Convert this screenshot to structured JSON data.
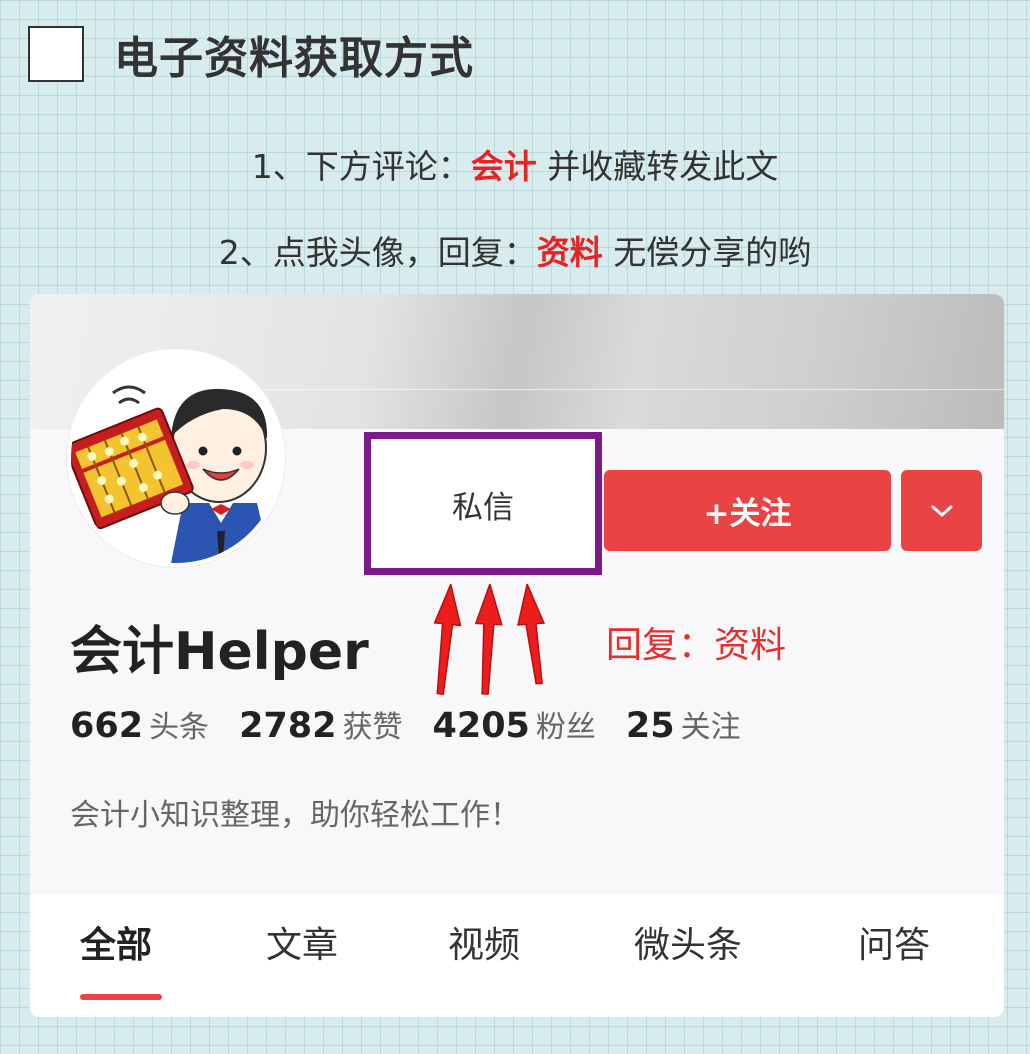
{
  "header": {
    "title": "电子资料获取方式"
  },
  "instructions": {
    "line1": {
      "prefix": "1、下方评论：",
      "highlight": "会计",
      "suffix": " 并收藏转发此文"
    },
    "line2": {
      "prefix": "2、点我头像，回复：",
      "highlight": "资料",
      "suffix": "  无偿分享的哟"
    }
  },
  "profile": {
    "name": "会计Helper",
    "message_button": "私信",
    "follow_button": "+关注",
    "more_icon": "chevron-down-icon",
    "reply_hint": "回复：资料",
    "stats": [
      {
        "value": "662",
        "label": "头条"
      },
      {
        "value": "2782",
        "label": "获赞"
      },
      {
        "value": "4205",
        "label": "粉丝"
      },
      {
        "value": "25",
        "label": "关注"
      }
    ],
    "bio": "会计小知识整理，助你轻松工作！"
  },
  "tabs": [
    {
      "label": "全部",
      "active": true
    },
    {
      "label": "文章",
      "active": false
    },
    {
      "label": "视频",
      "active": false
    },
    {
      "label": "微头条",
      "active": false
    },
    {
      "label": "问答",
      "active": false
    }
  ],
  "colors": {
    "accent": "#e94343",
    "highlight_frame": "#7b1b8a",
    "annotation": "#e62e2e"
  }
}
